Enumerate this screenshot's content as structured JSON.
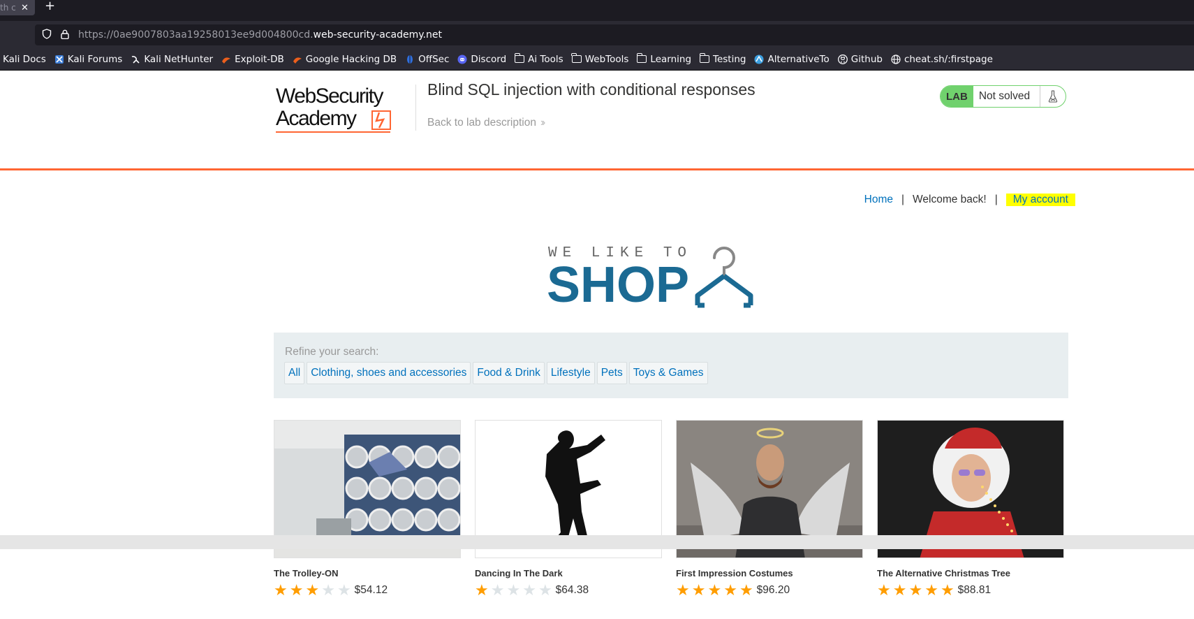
{
  "browser": {
    "tab_title": "th c",
    "tab_close": "✕",
    "new_tab": "+",
    "url_dim": "https://0ae9007803aa19258013ee9d004800cd.",
    "url_domain": "web-security-academy.net",
    "bookmarks": [
      {
        "label": "Kali Docs",
        "icon": "none"
      },
      {
        "label": "Kali Forums",
        "icon": "kali-forums-icon"
      },
      {
        "label": "Kali NetHunter",
        "icon": "nethunter-icon"
      },
      {
        "label": "Exploit-DB",
        "icon": "exploitdb-icon"
      },
      {
        "label": "Google Hacking DB",
        "icon": "ghdb-icon"
      },
      {
        "label": "OffSec",
        "icon": "offsec-icon"
      },
      {
        "label": "Discord",
        "icon": "discord-icon"
      },
      {
        "label": "Ai Tools",
        "icon": "folder-icon"
      },
      {
        "label": "WebTools",
        "icon": "folder-icon"
      },
      {
        "label": "Learning",
        "icon": "folder-icon"
      },
      {
        "label": "Testing",
        "icon": "folder-icon"
      },
      {
        "label": "AlternativeTo",
        "icon": "alternativeto-icon"
      },
      {
        "label": "Github",
        "icon": "github-icon"
      },
      {
        "label": "cheat.sh/:firstpage",
        "icon": "globe-icon"
      }
    ]
  },
  "header": {
    "logo_line1": "WebSecurity",
    "logo_line2": "Academy",
    "lab_title": "Blind SQL injection with conditional responses",
    "back_link": "Back to lab description",
    "lab_label": "LAB",
    "lab_status": "Not solved"
  },
  "nav": {
    "home": "Home",
    "sep": "|",
    "welcome": "Welcome back!",
    "my_account": "My account"
  },
  "shop_logo": {
    "tagline": "WE LIKE TO",
    "word": "SHOP"
  },
  "filter": {
    "label": "Refine your search:",
    "categories": [
      "All",
      "Clothing, shoes and accessories",
      "Food & Drink",
      "Lifestyle",
      "Pets",
      "Toys & Games"
    ]
  },
  "products": [
    {
      "name": "The Trolley-ON",
      "rating": 3,
      "price": "$54.12",
      "image": "laundromat-photo"
    },
    {
      "name": "Dancing In The Dark",
      "rating": 1,
      "price": "$64.38",
      "image": "dancer-silhouette"
    },
    {
      "name": "First Impression Costumes",
      "rating": 5,
      "price": "$96.20",
      "image": "angel-costume-photo"
    },
    {
      "name": "The Alternative Christmas Tree",
      "rating": 5,
      "price": "$88.81",
      "image": "santa-lights-photo"
    }
  ],
  "colors": {
    "accent": "#ff6633",
    "link": "#0071bc",
    "lab_green": "#70d16d",
    "shop_blue": "#1b6a93",
    "star": "#ff9d00"
  }
}
